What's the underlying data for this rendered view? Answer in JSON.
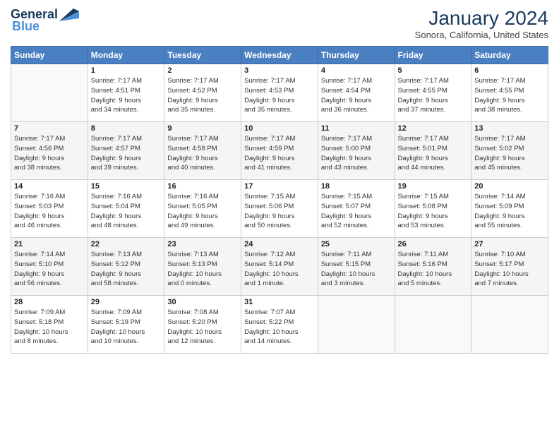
{
  "header": {
    "logo_general": "General",
    "logo_blue": "Blue",
    "title": "January 2024",
    "location": "Sonora, California, United States"
  },
  "columns": [
    "Sunday",
    "Monday",
    "Tuesday",
    "Wednesday",
    "Thursday",
    "Friday",
    "Saturday"
  ],
  "weeks": [
    [
      {
        "day": "",
        "info": ""
      },
      {
        "day": "1",
        "info": "Sunrise: 7:17 AM\nSunset: 4:51 PM\nDaylight: 9 hours\nand 34 minutes."
      },
      {
        "day": "2",
        "info": "Sunrise: 7:17 AM\nSunset: 4:52 PM\nDaylight: 9 hours\nand 35 minutes."
      },
      {
        "day": "3",
        "info": "Sunrise: 7:17 AM\nSunset: 4:53 PM\nDaylight: 9 hours\nand 35 minutes."
      },
      {
        "day": "4",
        "info": "Sunrise: 7:17 AM\nSunset: 4:54 PM\nDaylight: 9 hours\nand 36 minutes."
      },
      {
        "day": "5",
        "info": "Sunrise: 7:17 AM\nSunset: 4:55 PM\nDaylight: 9 hours\nand 37 minutes."
      },
      {
        "day": "6",
        "info": "Sunrise: 7:17 AM\nSunset: 4:55 PM\nDaylight: 9 hours\nand 38 minutes."
      }
    ],
    [
      {
        "day": "7",
        "info": "Sunrise: 7:17 AM\nSunset: 4:56 PM\nDaylight: 9 hours\nand 38 minutes."
      },
      {
        "day": "8",
        "info": "Sunrise: 7:17 AM\nSunset: 4:57 PM\nDaylight: 9 hours\nand 39 minutes."
      },
      {
        "day": "9",
        "info": "Sunrise: 7:17 AM\nSunset: 4:58 PM\nDaylight: 9 hours\nand 40 minutes."
      },
      {
        "day": "10",
        "info": "Sunrise: 7:17 AM\nSunset: 4:59 PM\nDaylight: 9 hours\nand 41 minutes."
      },
      {
        "day": "11",
        "info": "Sunrise: 7:17 AM\nSunset: 5:00 PM\nDaylight: 9 hours\nand 43 minutes."
      },
      {
        "day": "12",
        "info": "Sunrise: 7:17 AM\nSunset: 5:01 PM\nDaylight: 9 hours\nand 44 minutes."
      },
      {
        "day": "13",
        "info": "Sunrise: 7:17 AM\nSunset: 5:02 PM\nDaylight: 9 hours\nand 45 minutes."
      }
    ],
    [
      {
        "day": "14",
        "info": "Sunrise: 7:16 AM\nSunset: 5:03 PM\nDaylight: 9 hours\nand 46 minutes."
      },
      {
        "day": "15",
        "info": "Sunrise: 7:16 AM\nSunset: 5:04 PM\nDaylight: 9 hours\nand 48 minutes."
      },
      {
        "day": "16",
        "info": "Sunrise: 7:16 AM\nSunset: 5:05 PM\nDaylight: 9 hours\nand 49 minutes."
      },
      {
        "day": "17",
        "info": "Sunrise: 7:15 AM\nSunset: 5:06 PM\nDaylight: 9 hours\nand 50 minutes."
      },
      {
        "day": "18",
        "info": "Sunrise: 7:15 AM\nSunset: 5:07 PM\nDaylight: 9 hours\nand 52 minutes."
      },
      {
        "day": "19",
        "info": "Sunrise: 7:15 AM\nSunset: 5:08 PM\nDaylight: 9 hours\nand 53 minutes."
      },
      {
        "day": "20",
        "info": "Sunrise: 7:14 AM\nSunset: 5:09 PM\nDaylight: 9 hours\nand 55 minutes."
      }
    ],
    [
      {
        "day": "21",
        "info": "Sunrise: 7:14 AM\nSunset: 5:10 PM\nDaylight: 9 hours\nand 56 minutes."
      },
      {
        "day": "22",
        "info": "Sunrise: 7:13 AM\nSunset: 5:12 PM\nDaylight: 9 hours\nand 58 minutes."
      },
      {
        "day": "23",
        "info": "Sunrise: 7:13 AM\nSunset: 5:13 PM\nDaylight: 10 hours\nand 0 minutes."
      },
      {
        "day": "24",
        "info": "Sunrise: 7:12 AM\nSunset: 5:14 PM\nDaylight: 10 hours\nand 1 minute."
      },
      {
        "day": "25",
        "info": "Sunrise: 7:11 AM\nSunset: 5:15 PM\nDaylight: 10 hours\nand 3 minutes."
      },
      {
        "day": "26",
        "info": "Sunrise: 7:11 AM\nSunset: 5:16 PM\nDaylight: 10 hours\nand 5 minutes."
      },
      {
        "day": "27",
        "info": "Sunrise: 7:10 AM\nSunset: 5:17 PM\nDaylight: 10 hours\nand 7 minutes."
      }
    ],
    [
      {
        "day": "28",
        "info": "Sunrise: 7:09 AM\nSunset: 5:18 PM\nDaylight: 10 hours\nand 8 minutes."
      },
      {
        "day": "29",
        "info": "Sunrise: 7:09 AM\nSunset: 5:19 PM\nDaylight: 10 hours\nand 10 minutes."
      },
      {
        "day": "30",
        "info": "Sunrise: 7:08 AM\nSunset: 5:20 PM\nDaylight: 10 hours\nand 12 minutes."
      },
      {
        "day": "31",
        "info": "Sunrise: 7:07 AM\nSunset: 5:22 PM\nDaylight: 10 hours\nand 14 minutes."
      },
      {
        "day": "",
        "info": ""
      },
      {
        "day": "",
        "info": ""
      },
      {
        "day": "",
        "info": ""
      }
    ]
  ]
}
